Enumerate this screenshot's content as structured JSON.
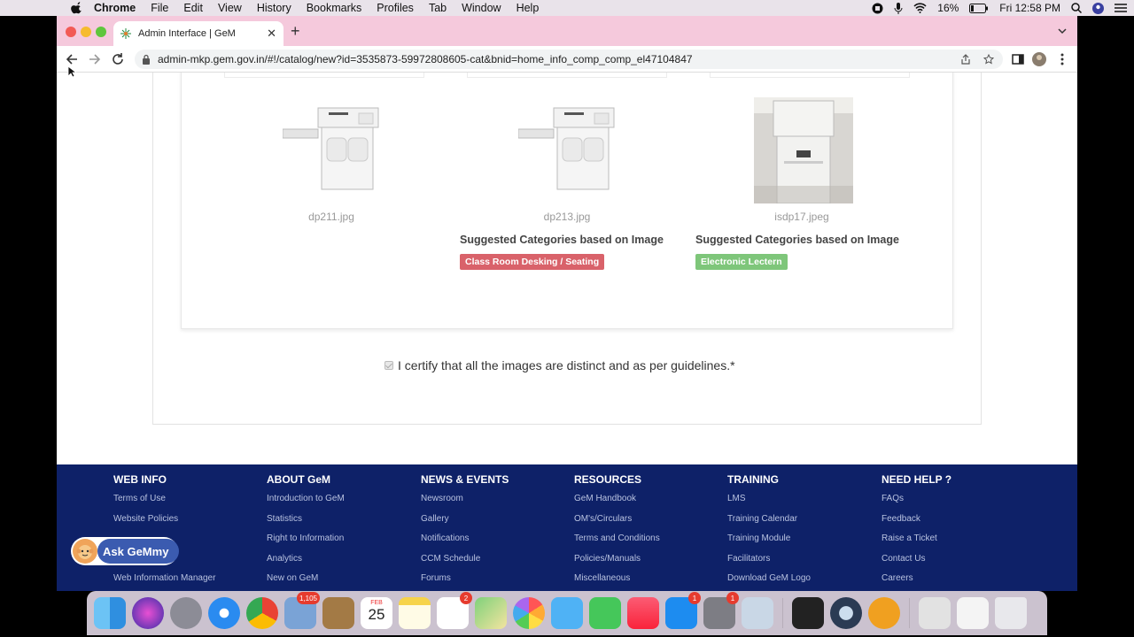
{
  "menubar": {
    "app_name": "Chrome",
    "items": [
      "File",
      "Edit",
      "View",
      "History",
      "Bookmarks",
      "Profiles",
      "Tab",
      "Window",
      "Help"
    ],
    "battery": "16%",
    "clock": "Fri 12:58 PM"
  },
  "browser": {
    "tab_title": "Admin Interface | GeM",
    "url": "admin-mkp.gem.gov.in/#!/catalog/new?id=3535873-59972808605-cat&bnid=home_info_comp_comp_el47104847"
  },
  "images": [
    {
      "filename": "dp211.jpg"
    },
    {
      "filename": "dp213.jpg",
      "suggestion_title": "Suggested Categories based on Image",
      "tag": "Class Room Desking / Seating",
      "tag_color": "#d9626a"
    },
    {
      "filename": "isdp17.jpeg",
      "suggestion_title": "Suggested Categories based on Image",
      "tag": "Electronic Lectern",
      "tag_color": "#7ec67a"
    }
  ],
  "certify_label": "I certify that all the images are distinct and as per guidelines.*",
  "footer": {
    "columns": [
      {
        "title": "WEB INFO",
        "links": [
          "Terms of Use",
          "Website Policies",
          "",
          "",
          "Web Information Manager"
        ]
      },
      {
        "title": "ABOUT GeM",
        "links": [
          "Introduction to GeM",
          "Statistics",
          "Right to Information",
          "Analytics",
          "New on GeM"
        ]
      },
      {
        "title": "NEWS & EVENTS",
        "links": [
          "Newsroom",
          "Gallery",
          "Notifications",
          "CCM Schedule",
          "Forums"
        ]
      },
      {
        "title": "RESOURCES",
        "links": [
          "GeM Handbook",
          "OM's/Circulars",
          "Terms and Conditions",
          "Policies/Manuals",
          "Miscellaneous"
        ]
      },
      {
        "title": "TRAINING",
        "links": [
          "LMS",
          "Training Calendar",
          "Training Module",
          "Facilitators",
          "Download GeM Logo"
        ]
      },
      {
        "title": "NEED HELP ?",
        "links": [
          "FAQs",
          "Feedback",
          "Raise a Ticket",
          "Contact Us",
          "Careers"
        ]
      }
    ]
  },
  "gemmy_label": "Ask GeMmy",
  "dock": {
    "badges": {
      "mail": "1,105",
      "reminders": "2",
      "appstore": "1",
      "settings": "1"
    },
    "calendar_month": "FEB",
    "calendar_day": "25"
  }
}
